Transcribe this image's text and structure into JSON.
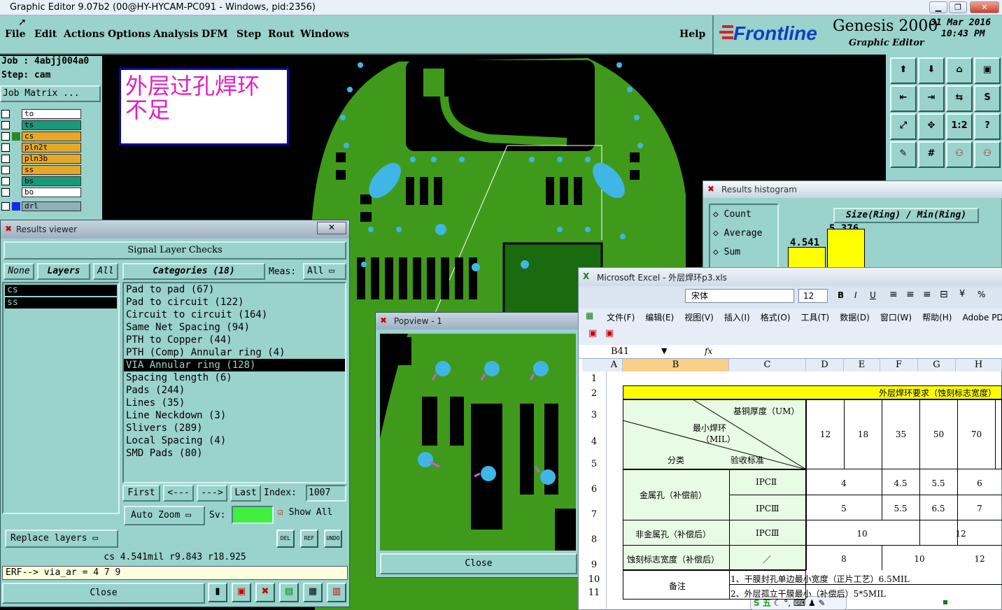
{
  "window": {
    "title": "Graphic Editor 9.07b2 (00@HY-HYCAM-PC091 - Windows, pid:2356)"
  },
  "menu": [
    "File",
    "Edit",
    "Actions",
    "Options",
    "Analysis",
    "DFM",
    "Step",
    "Rout",
    "Windows"
  ],
  "help": "Help",
  "brand": {
    "logo": "Frontline",
    "product": "Genesis 2000",
    "subtitle": "Graphic Editor",
    "date": "31 Mar 2016",
    "time": "10:43 PM"
  },
  "job": {
    "job": "Job : 4abjj004a0",
    "step": "Step: cam",
    "matrix": "Job Matrix ..."
  },
  "layers": [
    {
      "name": "to",
      "color": "#ffffff"
    },
    {
      "name": "ts",
      "color": "#1a9a7a"
    },
    {
      "name": "cs",
      "color": "#e6a82a"
    },
    {
      "name": "pln2t",
      "color": "#e6a82a"
    },
    {
      "name": "pln3b",
      "color": "#e6a82a"
    },
    {
      "name": "ss",
      "color": "#e6a82a"
    },
    {
      "name": "bs",
      "color": "#1a9a7a"
    },
    {
      "name": "bo",
      "color": "#ffffff"
    },
    {
      "name": "drl",
      "color": "#8fb0b8"
    }
  ],
  "annotation": {
    "line1": "外层过孔焊环",
    "line2": "不足"
  },
  "results_viewer": {
    "title": "Results viewer",
    "header": "Signal Layer Checks",
    "none": "None",
    "layers": "Layers",
    "all": "All",
    "categories": "Categories (18)",
    "meas": "Meas:",
    "meas_value": "All",
    "layer_list": [
      "cs",
      "ss"
    ],
    "items": [
      "Pad to pad (67)",
      "Pad to circuit (122)",
      "Circuit to circuit (164)",
      "Same Net Spacing (94)",
      "PTH to Copper (44)",
      "PTH (Comp) Annular ring (4)",
      "VIA Annular ring (128)",
      "Spacing length (6)",
      "Pads (244)",
      "Lines (35)",
      "Line Neckdown (3)",
      "Slivers (289)",
      "Local Spacing (4)",
      "SMD Pads (80)"
    ],
    "selected_index": 6,
    "first": "First",
    "prev": "<---",
    "next": "--->",
    "last": "Last",
    "index_label": "Index:",
    "index_value": "1007",
    "auto_zoom": "Auto Zoom",
    "sv": "Sv:",
    "show_all": "Show All",
    "replace_layers": "Replace layers",
    "del": "DEL",
    "ref": "REF",
    "undo": "UNDO",
    "status": "cs 4.541mil  r9.843  r18.925",
    "erf": "ERF--> via_ar = 4 7 9",
    "close": "Close"
  },
  "histogram": {
    "title": "Results histogram",
    "options": [
      "Count",
      "Average",
      "Sum"
    ],
    "heading": "Size(Ring) / Min(Ring)",
    "bars": [
      {
        "label": "4.541",
        "value": 4.541
      },
      {
        "label": "5.376",
        "value": 5.376
      }
    ]
  },
  "popview": {
    "title": "Popview - 1",
    "close": "Close"
  },
  "excel": {
    "title": "Microsoft Excel - 外层焊环p3.xls",
    "font": "宋体",
    "size": "12",
    "menu": [
      "文件(F)",
      "编辑(E)",
      "视图(V)",
      "插入(I)",
      "格式(O)",
      "工具(T)",
      "数据(D)",
      "窗口(W)",
      "帮助(H)",
      "Adobe PDF"
    ],
    "cellref": "B41",
    "fx": "fx",
    "cols": [
      "A",
      "B",
      "C",
      "D",
      "E",
      "F",
      "G",
      "H"
    ],
    "rows": [
      "1",
      "2",
      "3",
      "4",
      "5",
      "6",
      "7",
      "8",
      "9",
      "10",
      "11"
    ],
    "table_title": "外层焊环要求（蚀刻标志宽度）",
    "hdr_copper": "基铜厚度（UM）",
    "hdr_min": "最小焊环",
    "hdr_mil": "（MIL）",
    "hdr_class": "分类",
    "hdr_std": "验收标准",
    "thick": [
      "12",
      "18",
      "35",
      "50",
      "70"
    ],
    "metal": "金属孔（补偿前）",
    "ipc2": "IPCⅡ",
    "ipc3": "IPCⅢ",
    "r6": [
      "4",
      "4.5",
      "5.5",
      "6"
    ],
    "r7": [
      "5",
      "5.5",
      "6.5",
      "7"
    ],
    "nonmetal": "非金属孔（补偿后）",
    "r8": [
      "10",
      "12"
    ],
    "etch": "蚀刻标志宽度（补偿后）",
    "slash": "／",
    "r9": [
      "8",
      "10",
      "12"
    ],
    "remark": "备注",
    "note1": "1、干膜封孔单边最小宽度（正片工艺）6.5MIL",
    "note2": "2、外层孤立干膜最小（补偿后）5*5MIL",
    "ime": "S 五"
  },
  "colors": {
    "teal": "#9ad2cc",
    "pcb": "#3f9a1c",
    "via": "#3fb6e6",
    "highlight": "#ffff00",
    "annot": "#e020c0"
  }
}
